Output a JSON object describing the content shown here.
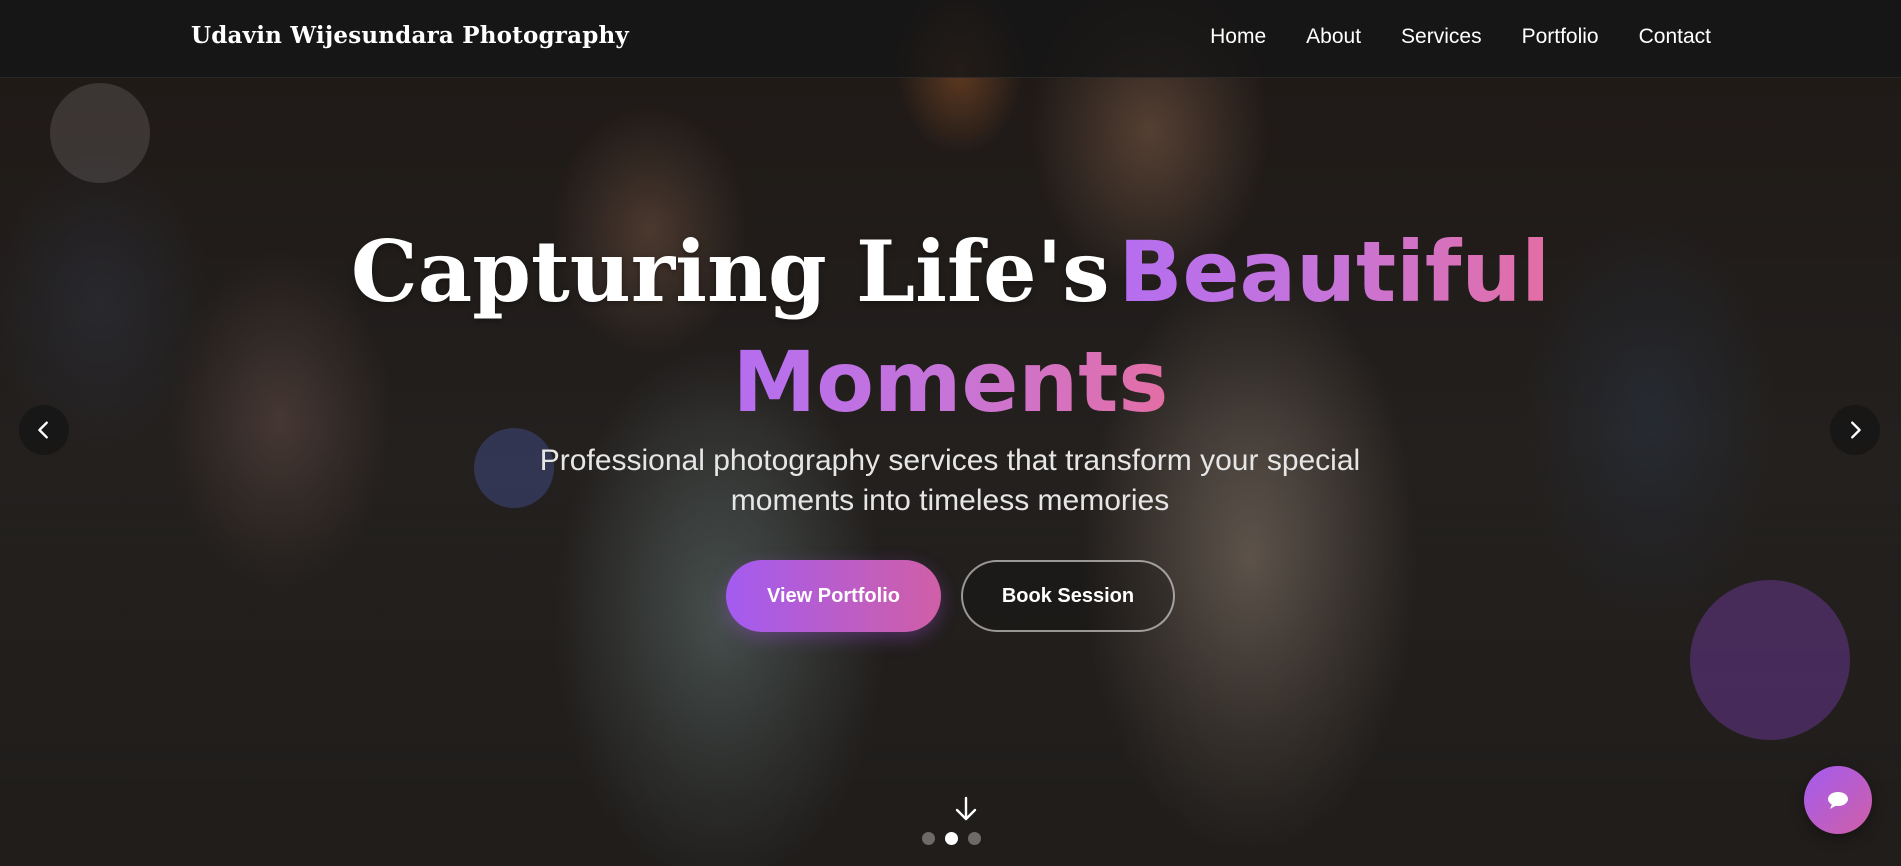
{
  "brand": {
    "name": "Udavin Wijesundara Photography"
  },
  "nav": {
    "items": [
      {
        "label": "Home"
      },
      {
        "label": "About"
      },
      {
        "label": "Services"
      },
      {
        "label": "Portfolio"
      },
      {
        "label": "Contact"
      }
    ]
  },
  "hero": {
    "headline_plain": "Capturing Life's",
    "headline_highlight_1": "Beautiful",
    "headline_highlight_2": "Moments",
    "subtitle_line_1": "Professional photography services that transform your special",
    "subtitle_line_2": "moments into timeless memories",
    "primary_cta": "View Portfolio",
    "secondary_cta": "Book Session"
  },
  "carousel": {
    "slide_count": 3,
    "active_index": 1
  },
  "icons": {
    "prev": "chevron-left-icon",
    "next": "chevron-right-icon",
    "scroll": "arrow-down-icon",
    "chat": "chat-icon"
  },
  "colors": {
    "accent_start": "#a35bf0",
    "accent_end": "#d05fa6",
    "navbar_bg": "#161616"
  }
}
